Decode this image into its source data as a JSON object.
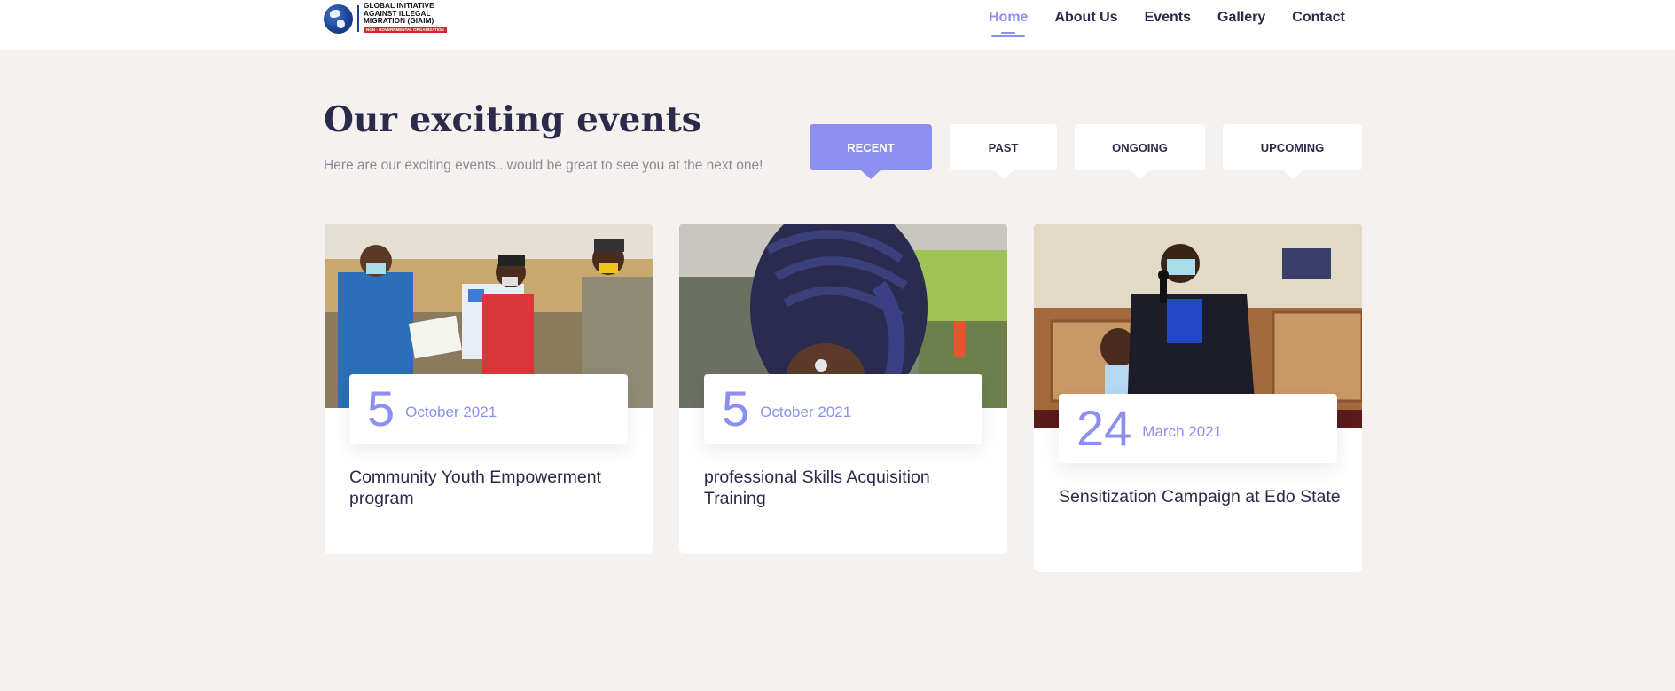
{
  "header": {
    "logo": {
      "lines": [
        "GLOBAL INITIATIVE",
        "AGAINST ILLEGAL",
        "MIGRATION (GIAIM)"
      ],
      "tagline": "NON - GOVERNMENTAL ORGANISATION"
    },
    "nav": [
      {
        "label": "Home",
        "active": true
      },
      {
        "label": "About Us",
        "active": false
      },
      {
        "label": "Events",
        "active": false
      },
      {
        "label": "Gallery",
        "active": false
      },
      {
        "label": "Contact",
        "active": false
      }
    ]
  },
  "section": {
    "title": "Our exciting events",
    "subtitle": "Here are our exciting events...would be great to see you at the next one!"
  },
  "tabs": [
    {
      "label": "RECENT",
      "active": true
    },
    {
      "label": "PAST",
      "active": false
    },
    {
      "label": "ONGOING",
      "active": false
    },
    {
      "label": "UPCOMING",
      "active": false
    }
  ],
  "events": [
    {
      "day": "5",
      "month": "October 2021",
      "title": "Community Youth Empowerment program"
    },
    {
      "day": "5",
      "month": "October 2021",
      "title": "professional Skills Acquisition Training"
    },
    {
      "day": "24",
      "month": "March 2021",
      "title": "Sensitization Campaign at Edo State"
    }
  ],
  "colors": {
    "accent": "#8b8ff0",
    "text": "#2c2a4a",
    "background": "#f4f1ee",
    "logo_red": "#d9232d",
    "logo_blue": "#1b3f8f"
  }
}
